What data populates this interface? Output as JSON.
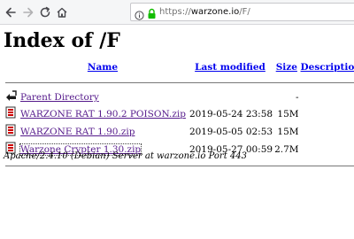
{
  "browser": {
    "url_prefix": "https://",
    "url_host": "warzone.io",
    "url_path": "/F/"
  },
  "page": {
    "title": "Index of /F",
    "columns": {
      "name": "Name",
      "last_modified": "Last modified",
      "size": "Size",
      "description": "Description"
    },
    "parent": {
      "label": "Parent Directory",
      "size": "-"
    },
    "rows": [
      {
        "name": "WARZONE RAT 1.90.2 POISON.zip",
        "modified": "2019-05-24 23:58",
        "size": "15M"
      },
      {
        "name": "WARZONE RAT 1.90.zip",
        "modified": "2019-05-05 02:53",
        "size": "15M"
      },
      {
        "name": "Warzone Crypter 1.30.zip",
        "modified": "2019-05-27 00:59",
        "size": "2.7M"
      }
    ],
    "server_signature": "Apache/2.4.10 (Debian) Server at warzone.io Port 443"
  },
  "colors": {
    "link": "#0000ee",
    "visited": "#551a8b",
    "lock_green": "#12bc00"
  }
}
